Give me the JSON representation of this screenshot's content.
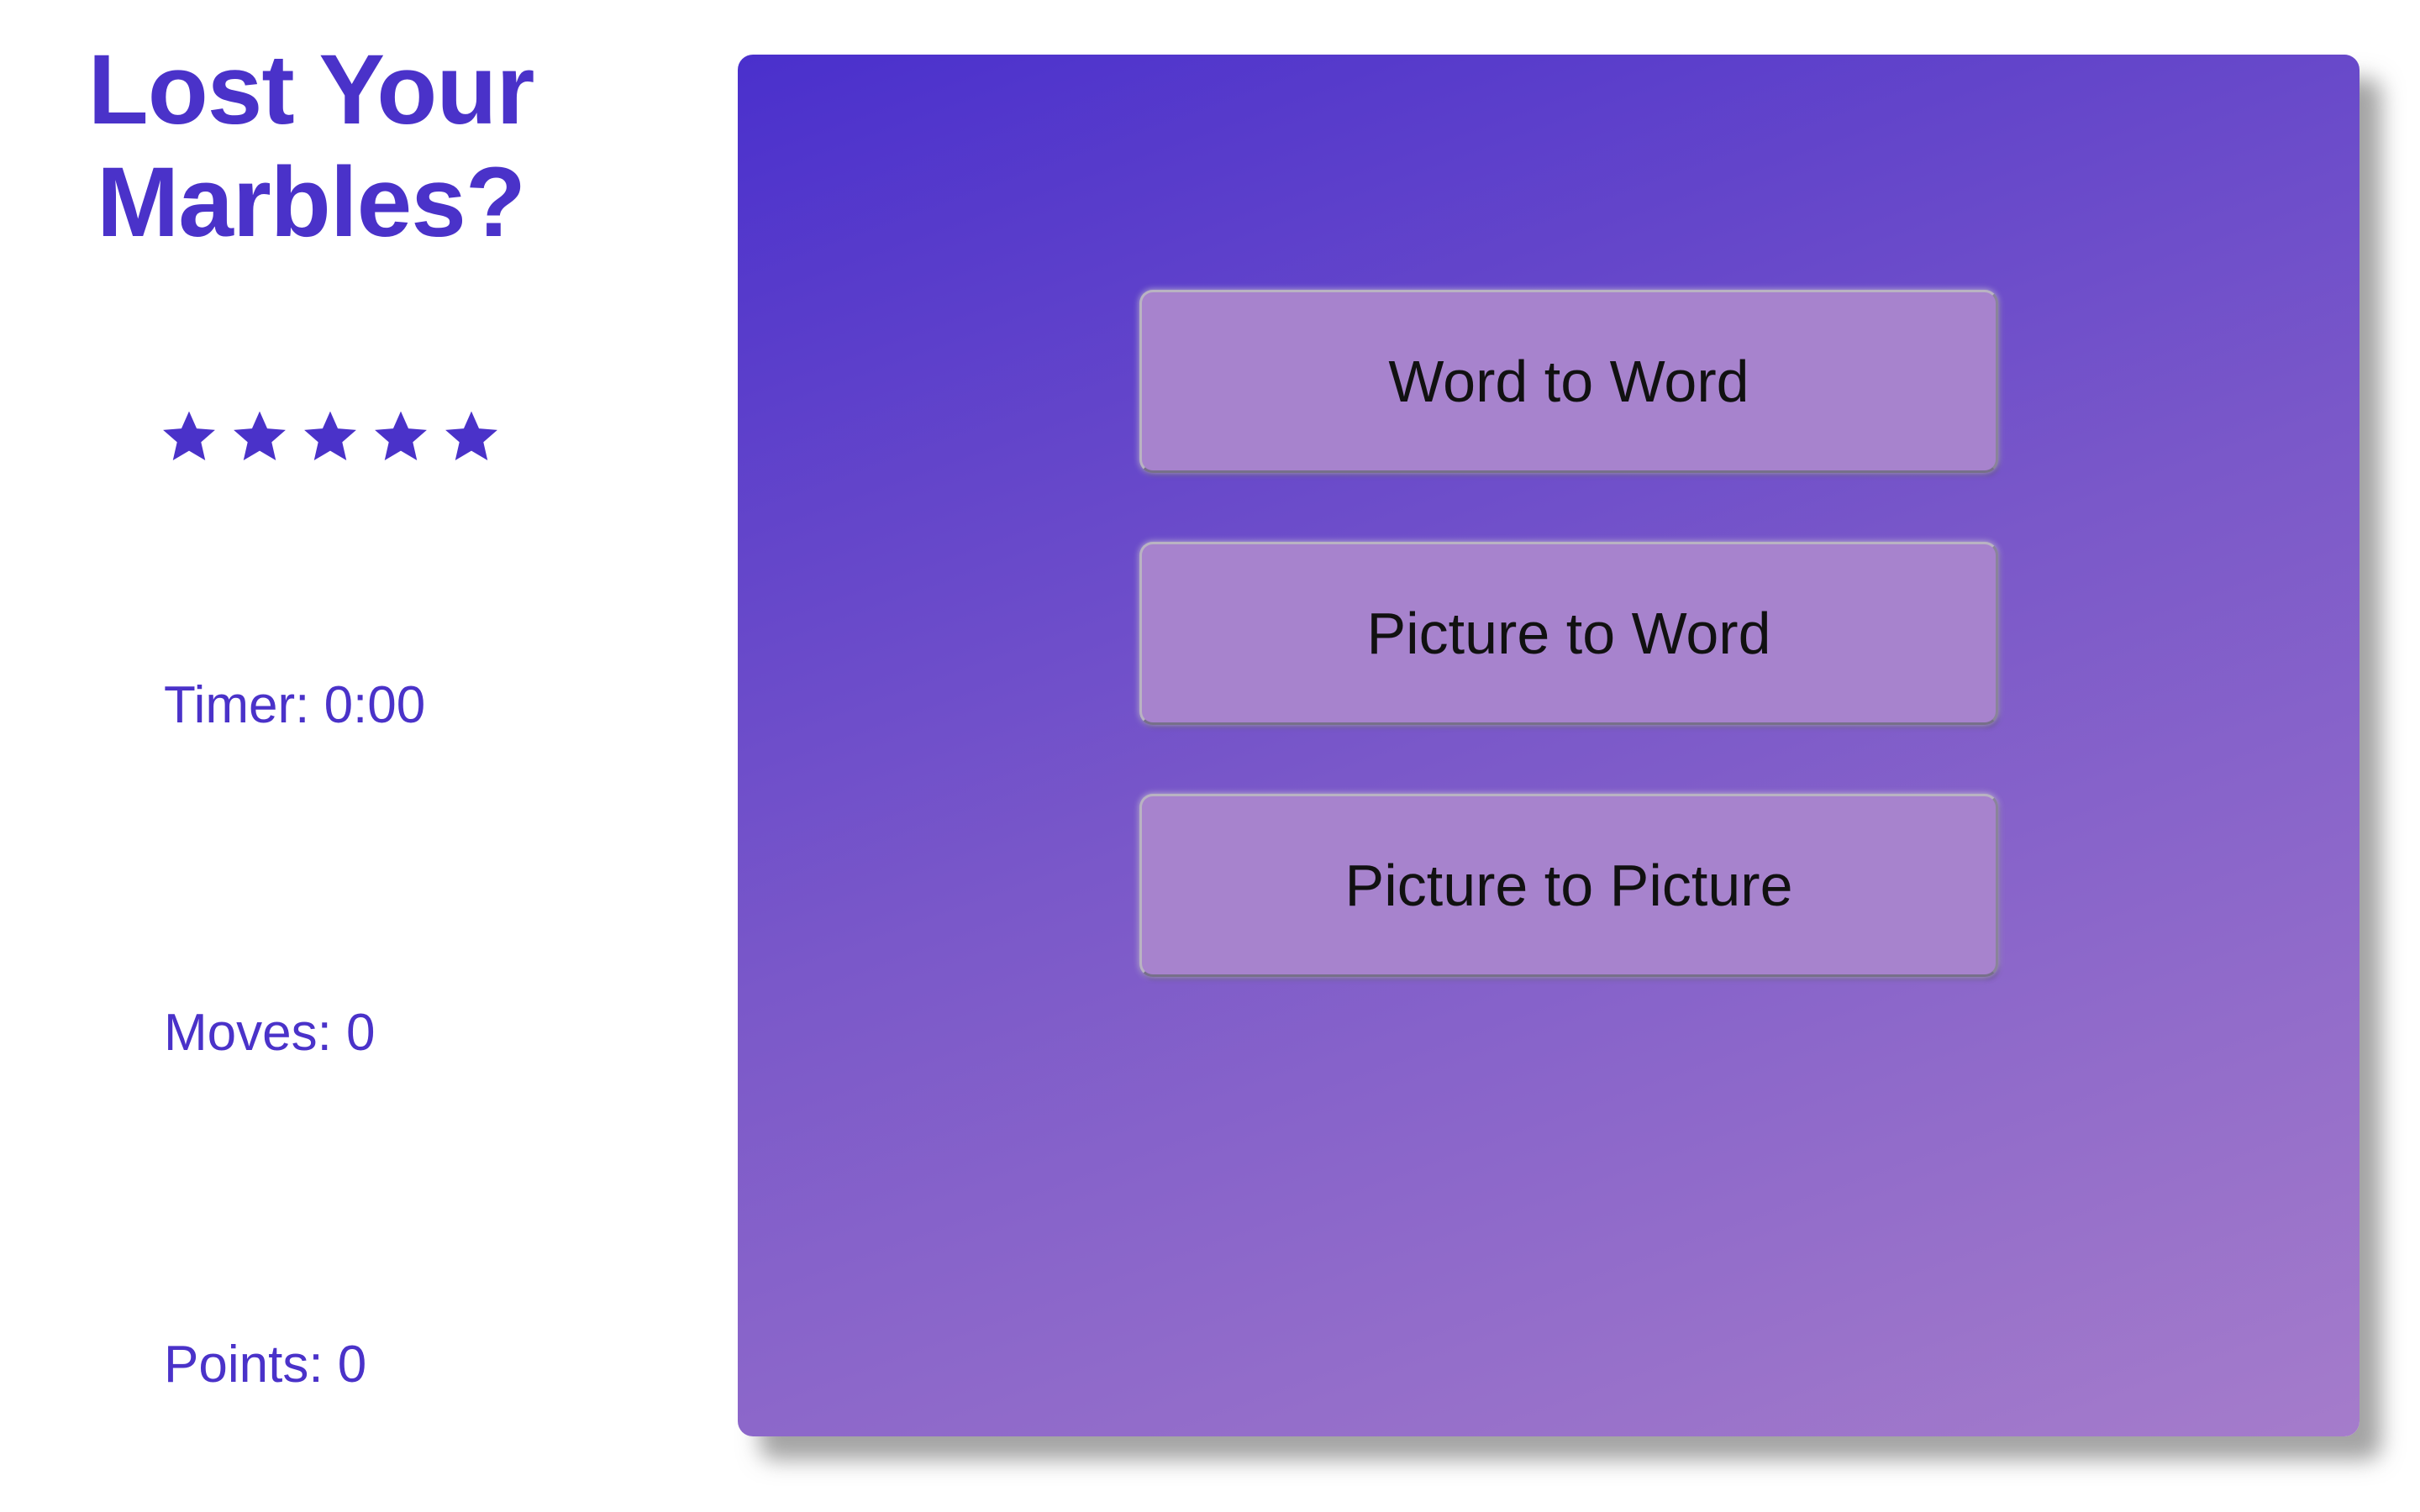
{
  "sidebar": {
    "title_line1": "Lost Your",
    "title_line2": "Marbles?",
    "rating": {
      "stars_filled": 5,
      "stars_total": 5,
      "icon": "star-icon"
    },
    "timer": "Timer: 0:00",
    "moves": "Moves: 0",
    "points": "Points: 0"
  },
  "game_modes": [
    {
      "label": "Word to Word"
    },
    {
      "label": "Picture to Word"
    },
    {
      "label": "Picture to Picture"
    }
  ],
  "colors": {
    "accent": "#4a32c9",
    "board_gradient_start": "#4a30cc",
    "board_gradient_end": "#a57ccb",
    "button_fill": "#a783cd"
  }
}
